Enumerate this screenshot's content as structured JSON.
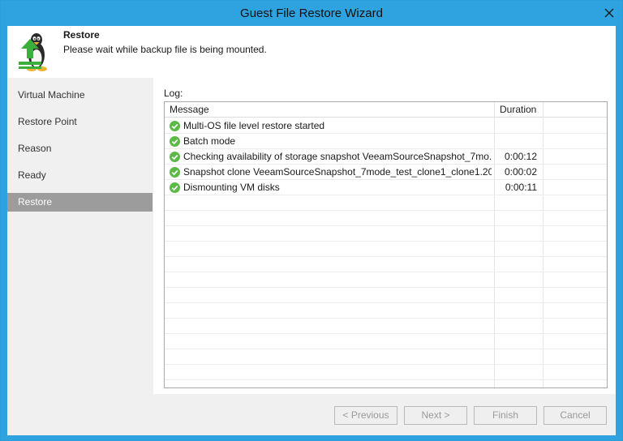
{
  "window": {
    "title": "Guest File Restore Wizard"
  },
  "header": {
    "title": "Restore",
    "subtitle": "Please wait while backup file is being mounted.",
    "icon": "linux-penguin-upload-icon"
  },
  "nav": {
    "items": [
      {
        "label": "Virtual Machine",
        "active": false
      },
      {
        "label": "Restore Point",
        "active": false
      },
      {
        "label": "Reason",
        "active": false
      },
      {
        "label": "Ready",
        "active": false
      },
      {
        "label": "Restore",
        "active": true
      }
    ]
  },
  "log": {
    "label": "Log:",
    "columns": {
      "message": "Message",
      "duration": "Duration"
    },
    "rows": [
      {
        "status": "success",
        "message": "Multi-OS file level restore started",
        "duration": ""
      },
      {
        "status": "success",
        "message": "Batch mode",
        "duration": ""
      },
      {
        "status": "success",
        "message": "Checking availability of storage snapshot VeeamSourceSnapshot_7mo...",
        "duration": "0:00:12"
      },
      {
        "status": "success",
        "message": "Snapshot clone VeeamSourceSnapshot_7mode_test_clone1_clone1.20...",
        "duration": "0:00:02"
      },
      {
        "status": "success",
        "message": "Dismounting VM disks",
        "duration": "0:00:11"
      }
    ]
  },
  "footer": {
    "previous_label": "< Previous",
    "next_label": "Next >",
    "finish_label": "Finish",
    "cancel_label": "Cancel"
  },
  "colors": {
    "title_bar": "#2ea3e0",
    "active_nav": "#9c9c9c",
    "success_icon": "#5db947"
  }
}
